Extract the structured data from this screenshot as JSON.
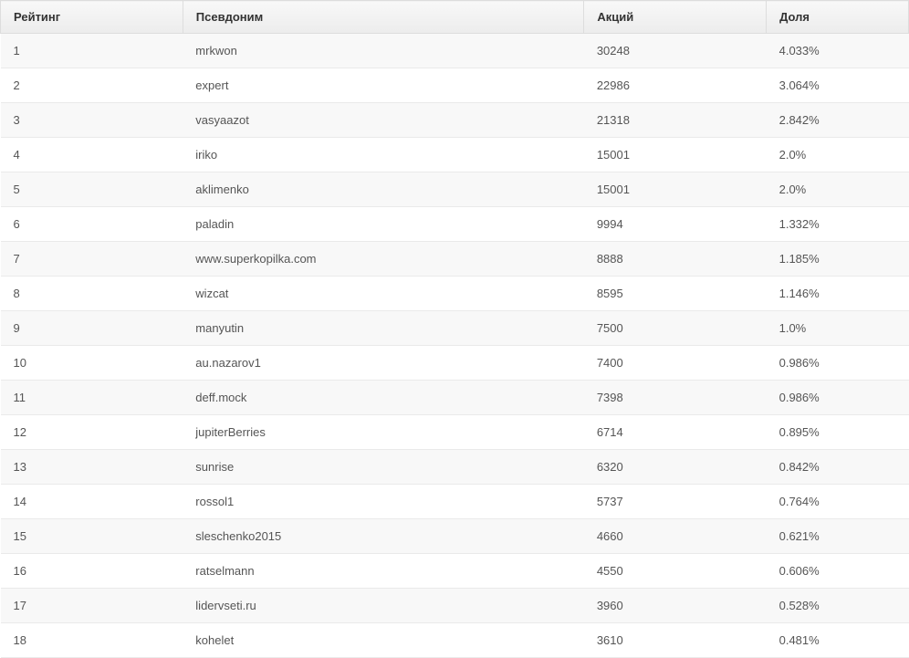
{
  "table": {
    "headers": {
      "rating": "Рейтинг",
      "pseudonym": "Псевдоним",
      "shares": "Акций",
      "share": "Доля"
    },
    "rows": [
      {
        "rating": "1",
        "pseudonym": "mrkwon",
        "shares": "30248",
        "share": "4.033%"
      },
      {
        "rating": "2",
        "pseudonym": "expert",
        "shares": "22986",
        "share": "3.064%"
      },
      {
        "rating": "3",
        "pseudonym": "vasyaazot",
        "shares": "21318",
        "share": "2.842%"
      },
      {
        "rating": "4",
        "pseudonym": "iriko",
        "shares": "15001",
        "share": "2.0%"
      },
      {
        "rating": "5",
        "pseudonym": "aklimenko",
        "shares": "15001",
        "share": "2.0%"
      },
      {
        "rating": "6",
        "pseudonym": "paladin",
        "shares": "9994",
        "share": "1.332%"
      },
      {
        "rating": "7",
        "pseudonym": "www.superkopilka.com",
        "shares": "8888",
        "share": "1.185%"
      },
      {
        "rating": "8",
        "pseudonym": "wizcat",
        "shares": "8595",
        "share": "1.146%"
      },
      {
        "rating": "9",
        "pseudonym": "manyutin",
        "shares": "7500",
        "share": "1.0%"
      },
      {
        "rating": "10",
        "pseudonym": "au.nazarov1",
        "shares": "7400",
        "share": "0.986%"
      },
      {
        "rating": "11",
        "pseudonym": "deff.mock",
        "shares": "7398",
        "share": "0.986%"
      },
      {
        "rating": "12",
        "pseudonym": "jupiterBerries",
        "shares": "6714",
        "share": "0.895%"
      },
      {
        "rating": "13",
        "pseudonym": "sunrise",
        "shares": "6320",
        "share": "0.842%"
      },
      {
        "rating": "14",
        "pseudonym": "rossol1",
        "shares": "5737",
        "share": "0.764%"
      },
      {
        "rating": "15",
        "pseudonym": "sleschenko2015",
        "shares": "4660",
        "share": "0.621%"
      },
      {
        "rating": "16",
        "pseudonym": "ratselmann",
        "shares": "4550",
        "share": "0.606%"
      },
      {
        "rating": "17",
        "pseudonym": "lidervseti.ru",
        "shares": "3960",
        "share": "0.528%"
      },
      {
        "rating": "18",
        "pseudonym": "kohelet",
        "shares": "3610",
        "share": "0.481%"
      }
    ]
  }
}
